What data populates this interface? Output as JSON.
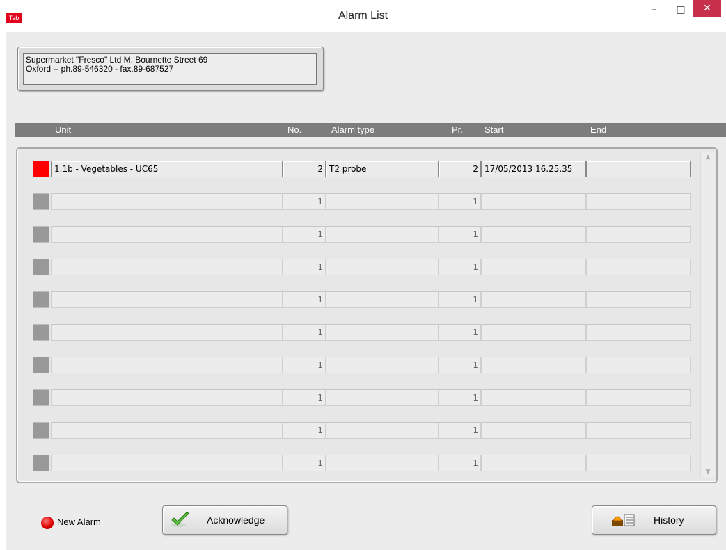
{
  "window": {
    "app_icon_text": "Tab",
    "title": "Alarm List",
    "minimize": "–",
    "maximize": "□",
    "close": "✕"
  },
  "address": {
    "line1": "Supermarket \"Fresco\" Ltd  M. Bournette Street 69",
    "line2": "Oxford  --  ph.89-546320 - fax.89-687527"
  },
  "columns": {
    "unit": "Unit",
    "no": "No.",
    "alarm_type": "Alarm type",
    "pr": "Pr.",
    "start": "Start",
    "end": "End"
  },
  "rows": [
    {
      "active": true,
      "unit": "1.1b - Vegetables - UC65",
      "no": "2",
      "alarm_type": "T2 probe",
      "pr": "2",
      "start": "17/05/2013 16.25.35",
      "end": ""
    },
    {
      "active": false,
      "unit": "",
      "no": "1",
      "alarm_type": "",
      "pr": "1",
      "start": "",
      "end": ""
    },
    {
      "active": false,
      "unit": "",
      "no": "1",
      "alarm_type": "",
      "pr": "1",
      "start": "",
      "end": ""
    },
    {
      "active": false,
      "unit": "",
      "no": "1",
      "alarm_type": "",
      "pr": "1",
      "start": "",
      "end": ""
    },
    {
      "active": false,
      "unit": "",
      "no": "1",
      "alarm_type": "",
      "pr": "1",
      "start": "",
      "end": ""
    },
    {
      "active": false,
      "unit": "",
      "no": "1",
      "alarm_type": "",
      "pr": "1",
      "start": "",
      "end": ""
    },
    {
      "active": false,
      "unit": "",
      "no": "1",
      "alarm_type": "",
      "pr": "1",
      "start": "",
      "end": ""
    },
    {
      "active": false,
      "unit": "",
      "no": "1",
      "alarm_type": "",
      "pr": "1",
      "start": "",
      "end": ""
    },
    {
      "active": false,
      "unit": "",
      "no": "1",
      "alarm_type": "",
      "pr": "1",
      "start": "",
      "end": ""
    },
    {
      "active": false,
      "unit": "",
      "no": "1",
      "alarm_type": "",
      "pr": "1",
      "start": "",
      "end": ""
    }
  ],
  "legend": {
    "new_alarm": "New Alarm"
  },
  "buttons": {
    "acknowledge": "Acknowledge",
    "history": "History"
  },
  "colors": {
    "alarm_active": "#ff0000",
    "alarm_idle": "#999999",
    "header_bg": "#7d7d7d"
  },
  "icons": {
    "acknowledge": "check-icon",
    "history": "alarm-light-icon",
    "new_alarm": "red-led-icon"
  }
}
